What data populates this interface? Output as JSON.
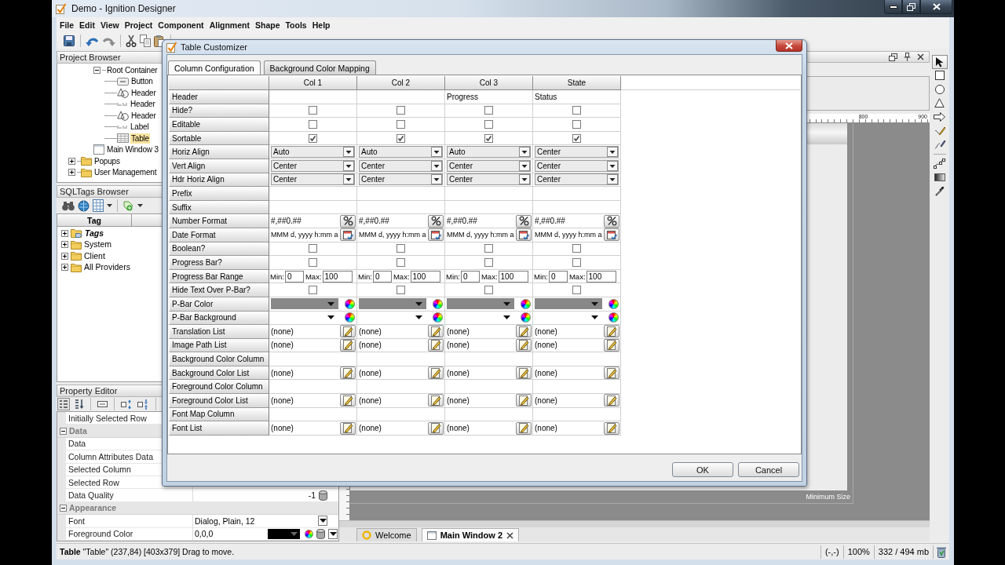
{
  "window": {
    "title": "Demo - Ignition Designer"
  },
  "menu": [
    "File",
    "Edit",
    "View",
    "Project",
    "Component",
    "Alignment",
    "Shape",
    "Tools",
    "Help"
  ],
  "project_browser": {
    "title": "Project Browser",
    "tree": [
      {
        "label": "Root Container",
        "kind": "container",
        "selected": false,
        "expanded": true,
        "children": [
          {
            "label": "Button",
            "kind": "button",
            "selected": false
          },
          {
            "label": "Header",
            "kind": "shape",
            "selected": false
          },
          {
            "label": "Header",
            "kind": "label",
            "selected": false
          },
          {
            "label": "Header",
            "kind": "shape",
            "selected": false
          },
          {
            "label": "Label",
            "kind": "label",
            "selected": false
          },
          {
            "label": "Table",
            "kind": "table",
            "selected": true
          }
        ]
      },
      {
        "label": "Main Window 3",
        "kind": "window",
        "selected": false
      },
      {
        "label": "Popups",
        "kind": "folder",
        "selected": false,
        "expanded": false
      },
      {
        "label": "User Management",
        "kind": "folder",
        "selected": false,
        "expanded": false
      }
    ]
  },
  "sqltags_browser": {
    "title": "SQLTags Browser",
    "column": "Tag",
    "tree": [
      {
        "label": "Tags",
        "kind": "provider",
        "expanded": false
      },
      {
        "label": "System",
        "kind": "folder",
        "expanded": false
      },
      {
        "label": "Client",
        "kind": "folder",
        "expanded": false
      },
      {
        "label": "All Providers",
        "kind": "folder",
        "expanded": false
      }
    ]
  },
  "property_editor": {
    "title": "Property Editor",
    "properties": [
      {
        "name": "Initially Selected Row"
      }
    ],
    "sections": [
      {
        "name": "Data",
        "expanded": true,
        "properties": [
          {
            "name": "Data"
          },
          {
            "name": "Column Attributes Data"
          },
          {
            "name": "Selected Column"
          },
          {
            "name": "Selected Row"
          },
          {
            "name": "Data Quality",
            "kind": "number",
            "value": "-1"
          }
        ]
      },
      {
        "name": "Appearance",
        "expanded": true,
        "properties": [
          {
            "name": "Font",
            "kind": "font",
            "value": "Dialog, Plain, 12"
          },
          {
            "name": "Foreground Color",
            "kind": "color",
            "value": "0,0,0",
            "color": "#000000"
          }
        ]
      }
    ]
  },
  "dialog": {
    "title": "Table Customizer",
    "tabs": [
      {
        "label": "Column Configuration",
        "selected": true
      },
      {
        "label": "Background Color Mapping",
        "selected": false
      }
    ],
    "columns": [
      "Col 1",
      "Col 2",
      "Col 3",
      "State"
    ],
    "rows": [
      {
        "label": "Header",
        "kind": "text",
        "cells": [
          null,
          null,
          "Progress",
          "Status"
        ]
      },
      {
        "label": "Hide?",
        "kind": "checkbox",
        "cells": [
          {
            "checked": false
          },
          {
            "checked": false
          },
          {
            "checked": false
          },
          {
            "checked": false
          }
        ]
      },
      {
        "label": "Editable",
        "kind": "checkbox",
        "cells": [
          {
            "checked": false
          },
          {
            "checked": false
          },
          {
            "checked": false
          },
          {
            "checked": false
          }
        ]
      },
      {
        "label": "Sortable",
        "kind": "checkbox",
        "cells": [
          {
            "checked": true
          },
          {
            "checked": true
          },
          {
            "checked": true
          },
          {
            "checked": true
          }
        ]
      },
      {
        "label": "Horiz Align",
        "kind": "dropdown",
        "cells": [
          "Auto",
          "Auto",
          "Auto",
          "Center"
        ]
      },
      {
        "label": "Vert Align",
        "kind": "dropdown",
        "cells": [
          "Center",
          "Center",
          "Center",
          "Center"
        ]
      },
      {
        "label": "Hdr Horiz Align",
        "kind": "dropdown",
        "cells": [
          "Center",
          "Center",
          "Center",
          "Center"
        ]
      },
      {
        "label": "Prefix",
        "kind": "text"
      },
      {
        "label": "Suffix",
        "kind": "text"
      },
      {
        "label": "Number Format",
        "kind": "number",
        "cells": [
          "#,##0.##",
          "#,##0.##",
          "#,##0.##",
          "#,##0.##"
        ]
      },
      {
        "label": "Date Format",
        "kind": "date",
        "cells": [
          "MMM d, yyyy h:mm a",
          "MMM d, yyyy h:mm a",
          "MMM d, yyyy h:mm a",
          "MMM d, yyyy h:mm a"
        ]
      },
      {
        "label": "Boolean?",
        "kind": "checkbox",
        "cells": [
          {
            "checked": false
          },
          {
            "checked": false
          },
          {
            "checked": false
          },
          {
            "checked": false
          }
        ]
      },
      {
        "label": "Progress Bar?",
        "kind": "checkbox",
        "cells": [
          {
            "checked": false
          },
          {
            "checked": false
          },
          {
            "checked": false
          },
          {
            "checked": false
          }
        ]
      },
      {
        "label": "Progress Bar Range",
        "kind": "range",
        "cells": [
          {
            "min_label": "Min:",
            "min": "0",
            "max_label": "Max:",
            "max": "100"
          },
          {
            "min_label": "Min:",
            "min": "0",
            "max_label": "Max:",
            "max": "100"
          },
          {
            "min_label": "Min:",
            "min": "0",
            "max_label": "Max:",
            "max": "100"
          },
          {
            "min_label": "Min:",
            "min": "0",
            "max_label": "Max:",
            "max": "100"
          }
        ]
      },
      {
        "label": "Hide Text Over P-Bar?",
        "kind": "checkbox",
        "cells": [
          {
            "checked": false
          },
          {
            "checked": false
          },
          {
            "checked": false
          },
          {
            "checked": false
          }
        ]
      },
      {
        "label": "P-Bar Color",
        "kind": "color",
        "cells": [
          {
            "color": "#888888"
          },
          {
            "color": "#888888"
          },
          {
            "color": "#888888"
          },
          {
            "color": "#888888"
          }
        ]
      },
      {
        "label": "P-Bar Background",
        "kind": "color",
        "cells": [
          {
            "color": "#ffffff"
          },
          {
            "color": "#ffffff"
          },
          {
            "color": "#ffffff"
          },
          {
            "color": "#ffffff"
          }
        ]
      },
      {
        "label": "Translation List",
        "kind": "list",
        "cells": [
          "(none)",
          "(none)",
          "(none)",
          "(none)"
        ]
      },
      {
        "label": "Image Path List",
        "kind": "list",
        "cells": [
          "(none)",
          "(none)",
          "(none)",
          "(none)"
        ]
      },
      {
        "label": "Background Color Column",
        "kind": "text"
      },
      {
        "label": "Background Color List",
        "kind": "list",
        "cells": [
          "(none)",
          "(none)",
          "(none)",
          "(none)"
        ]
      },
      {
        "label": "Foreground Color Column",
        "kind": "text"
      },
      {
        "label": "Foreground Color List",
        "kind": "list",
        "cells": [
          "(none)",
          "(none)",
          "(none)",
          "(none)"
        ]
      },
      {
        "label": "Font Map Column",
        "kind": "text"
      },
      {
        "label": "Font List",
        "kind": "list",
        "cells": [
          "(none)",
          "(none)",
          "(none)",
          "(none)"
        ]
      }
    ],
    "buttons": [
      "OK",
      "Cancel"
    ]
  },
  "workspace": {
    "ruler_labels": [
      "800",
      "900"
    ],
    "minimum_size_label": "Minimum Size",
    "tabs": [
      {
        "label": "Welcome",
        "kind": "welcome",
        "selected": false
      },
      {
        "label": "Main Window 2",
        "kind": "window",
        "selected": true
      }
    ]
  },
  "tools": [
    {
      "kind": "pointer",
      "selected": true
    },
    {
      "kind": "rectangle",
      "selected": false
    },
    {
      "kind": "ellipse",
      "selected": false
    },
    {
      "kind": "polygon",
      "selected": false
    },
    {
      "kind": "arrow",
      "selected": false
    },
    {
      "kind": "pencil",
      "selected": false
    },
    {
      "kind": "pen",
      "selected": false
    },
    {
      "kind": "path",
      "selected": false
    },
    {
      "kind": "gradient",
      "selected": false
    },
    {
      "kind": "eyedropper",
      "selected": false
    }
  ],
  "status_bar": {
    "message": "**Table** \"Table\" (237,84) [403x379] Drag to move.",
    "coordinates": "(-,-)",
    "zoom": "100%",
    "memory": "332 / 494 mb"
  }
}
